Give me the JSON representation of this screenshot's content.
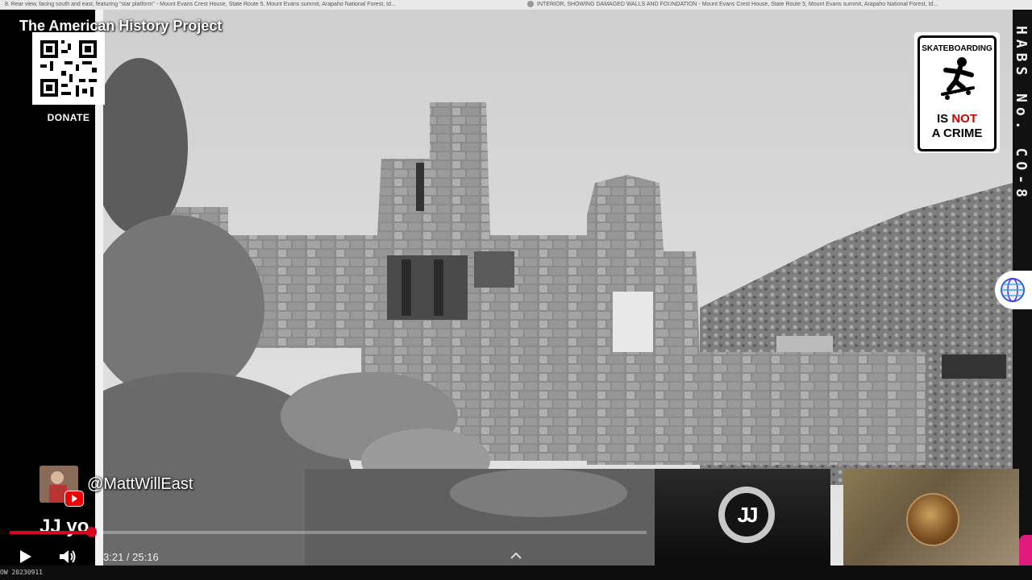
{
  "browser_tabs": [
    {
      "title": "8. Rear view, facing south and east, featuring \"star platform\" - Mount Evans Crest House, State Route 5, Mount Evans summit, Arapaho National Forest, Id..."
    },
    {
      "title": "INTERIOR, SHOWING DAMAGED WALLS AND FOUNDATION - Mount Evans Crest House, State Route 5, Mount Evans summit, Arapaho National Forest, Id..."
    }
  ],
  "overlay": {
    "channel_title": "The American History Project",
    "donate_label": "DONATE"
  },
  "sign": {
    "top": "SKATEBOARDING",
    "line1_prefix": "IS ",
    "line1_emphasis": "NOT",
    "line2": "A CRIME",
    "emphasis_color": "#d10000"
  },
  "photo_edge_text": "HABS No. CO-8",
  "chat": {
    "handle": "@MattWillEast",
    "message": "JJ yo"
  },
  "player": {
    "progress": 0.128,
    "current_time": "3:21",
    "duration": "25:16",
    "time_display": "3:21 / 25:16",
    "accent_color": "#d8001e"
  },
  "bottom_stamp": "OW 20230911",
  "icons": {
    "play": "play-icon",
    "volume": "volume-icon",
    "chevron": "chevron-up-icon",
    "globe": "globe-icon",
    "youtube": "youtube-icon"
  },
  "cam1_logo": "JJ"
}
